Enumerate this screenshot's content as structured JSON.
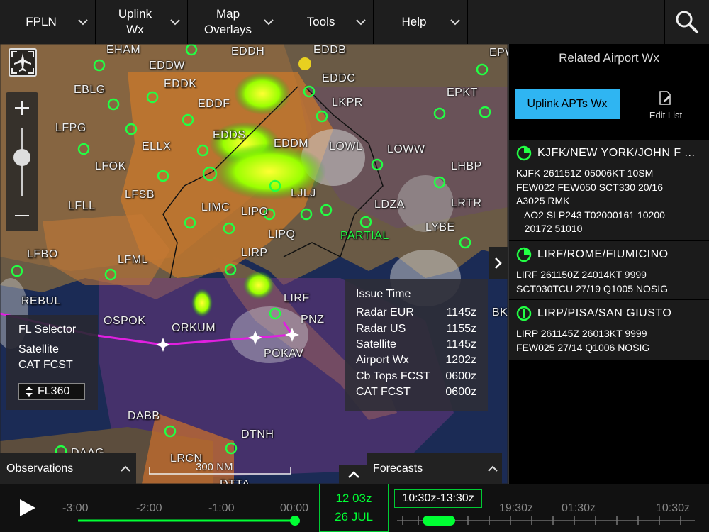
{
  "menu": {
    "fpln": "FPLN",
    "uplink_wx_1": "Uplink",
    "uplink_wx_2": "Wx",
    "map_overlays_1": "Map",
    "map_overlays_2": "Overlays",
    "tools": "Tools",
    "help": "Help"
  },
  "map": {
    "airports": [
      "EHAM",
      "EDDH",
      "EDDB",
      "EPWA",
      "EDDW",
      "EDDK",
      "EBLG",
      "EDDF",
      "EDDC",
      "LKPR",
      "EPKT",
      "LFPG",
      "EDDS",
      "EDDM",
      "LOWL",
      "LOWW",
      "ELLX",
      "LFOK",
      "LHBP",
      "LFSB",
      "LJLJ",
      "LFLL",
      "LIMC",
      "LIPO",
      "LDZA",
      "LRTR",
      "LIPQ",
      "LYBE",
      "LFBO",
      "LFML",
      "LIRP",
      "LIRF",
      "REBUL",
      "PNZ",
      "OSPOK",
      "ORKUM",
      "POKAV",
      "DABB",
      "DTNH",
      "DAAG",
      "DTTA",
      "LRCN",
      "BKPR"
    ],
    "partial_label": "PARTIAL",
    "scale": "300 NM"
  },
  "fl_selector": {
    "title": "FL Selector",
    "line1": "Satellite",
    "line2": "CAT FCST",
    "level": "FL360"
  },
  "issue_time": {
    "title": "Issue Time",
    "rows": [
      {
        "label": "Radar EUR",
        "value": "1145z"
      },
      {
        "label": "Radar US",
        "value": "1155z"
      },
      {
        "label": "Satellite",
        "value": "1145z"
      },
      {
        "label": "Airport Wx",
        "value": "1202z"
      },
      {
        "label": "Cb Tops FCST",
        "value": "0600z"
      },
      {
        "label": "CAT FCST",
        "value": "0600z"
      }
    ]
  },
  "panels": {
    "observations": "Observations",
    "forecasts": "Forecasts"
  },
  "sidebar": {
    "title": "Related Airport Wx",
    "uplink_button": "Uplink APTs Wx",
    "edit_list": "Edit List",
    "airports": [
      {
        "name": "KJFK/NEW YORK/JOHN F ...",
        "metar": "KJFK 261151Z 05006KT 10SM\nFEW022 FEW050 SCT330 20/16\nA3025 RMK\n   AO2 SLP243 T02000161 10200\n   20172 51010"
      },
      {
        "name": "LIRF/ROME/FIUMICINO",
        "metar": "LIRF 261150Z 24014KT 9999\nSCT030TCU 27/19 Q1005 NOSIG"
      },
      {
        "name": "LIRP/PISA/SAN GIUSTO",
        "metar": "LIRP 261145Z 26013KT 9999\nFEW025 27/14 Q1006 NOSIG"
      }
    ]
  },
  "timeline": {
    "ticks": [
      "-3:00",
      "-2:00",
      "-1:00",
      "00:00"
    ],
    "current_time": "12 03z",
    "current_date": "26 JUL",
    "forecast_range": "10:30z-13:30z",
    "forecast_ticks": [
      "19:30z",
      "01:30z",
      "10:30z"
    ],
    "progress_fraction": 1.0
  },
  "colors": {
    "accent_green": "#00ff33",
    "button_blue": "#2fb5f2",
    "route_magenta": "#e020e0"
  }
}
